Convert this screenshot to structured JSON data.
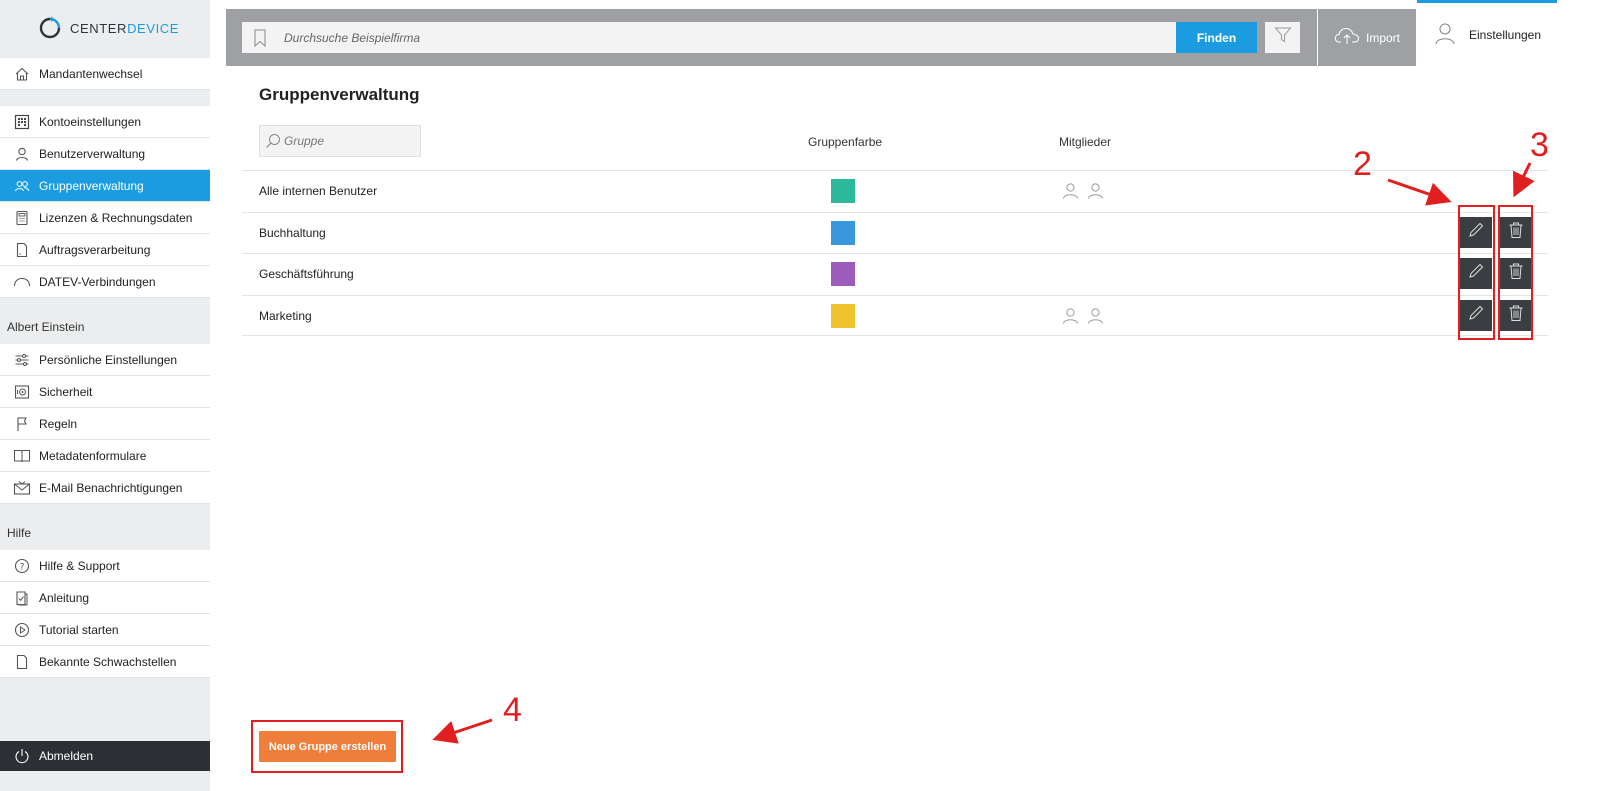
{
  "brand": {
    "name_prefix": "CENTER",
    "name_suffix": "DEVICE"
  },
  "sidebar": {
    "top_items": [
      {
        "label": "Mandantenwechsel",
        "icon": "home-icon"
      }
    ],
    "admin_items": [
      {
        "label": "Kontoeinstellungen",
        "icon": "grid-icon"
      },
      {
        "label": "Benutzerverwaltung",
        "icon": "user-icon"
      },
      {
        "label": "Gruppenverwaltung",
        "icon": "users-icon",
        "active": true
      },
      {
        "label": "Lizenzen & Rechnungsdaten",
        "icon": "calculator-icon"
      },
      {
        "label": "Auftragsverarbeitung",
        "icon": "document-icon"
      },
      {
        "label": "DATEV-Verbindungen",
        "icon": "cloud-icon"
      }
    ],
    "user_section_label": "Albert Einstein",
    "user_items": [
      {
        "label": "Persönliche Einstellungen",
        "icon": "sliders-icon"
      },
      {
        "label": "Sicherheit",
        "icon": "safe-icon"
      },
      {
        "label": "Regeln",
        "icon": "flag-icon"
      },
      {
        "label": "Metadatenformulare",
        "icon": "book-icon"
      },
      {
        "label": "E-Mail Benachrichtigungen",
        "icon": "mail-icon"
      }
    ],
    "help_section_label": "Hilfe",
    "help_items": [
      {
        "label": "Hilfe & Support",
        "icon": "question-icon"
      },
      {
        "label": "Anleitung",
        "icon": "checklist-icon"
      },
      {
        "label": "Tutorial starten",
        "icon": "play-icon"
      },
      {
        "label": "Bekannte Schwachstellen",
        "icon": "document-icon"
      }
    ],
    "logout_label": "Abmelden"
  },
  "topbar": {
    "search_placeholder": "Durchsuche Beispielfirma",
    "find_label": "Finden",
    "import_label": "Import",
    "settings_label": "Einstellungen"
  },
  "main": {
    "title": "Gruppenverwaltung",
    "filter_placeholder": "Gruppe",
    "col_color": "Gruppenfarbe",
    "col_members": "Mitglieder",
    "rows": [
      {
        "name": "Alle internen Benutzer",
        "color": "#2bbb9c",
        "members": 2,
        "editable": false
      },
      {
        "name": "Buchhaltung",
        "color": "#3b97dc",
        "members": 0,
        "editable": true
      },
      {
        "name": "Geschäftsführung",
        "color": "#9b5cbb",
        "members": 0,
        "editable": true
      },
      {
        "name": "Marketing",
        "color": "#f1c32c",
        "members": 2,
        "editable": true
      }
    ],
    "new_group_label": "Neue Gruppe erstellen"
  },
  "annotations": {
    "n2": "2",
    "n3": "3",
    "n4": "4"
  },
  "colors": {
    "accent": "#1c9ce0",
    "action": "#ef7e3a",
    "annotation": "#e02020"
  }
}
